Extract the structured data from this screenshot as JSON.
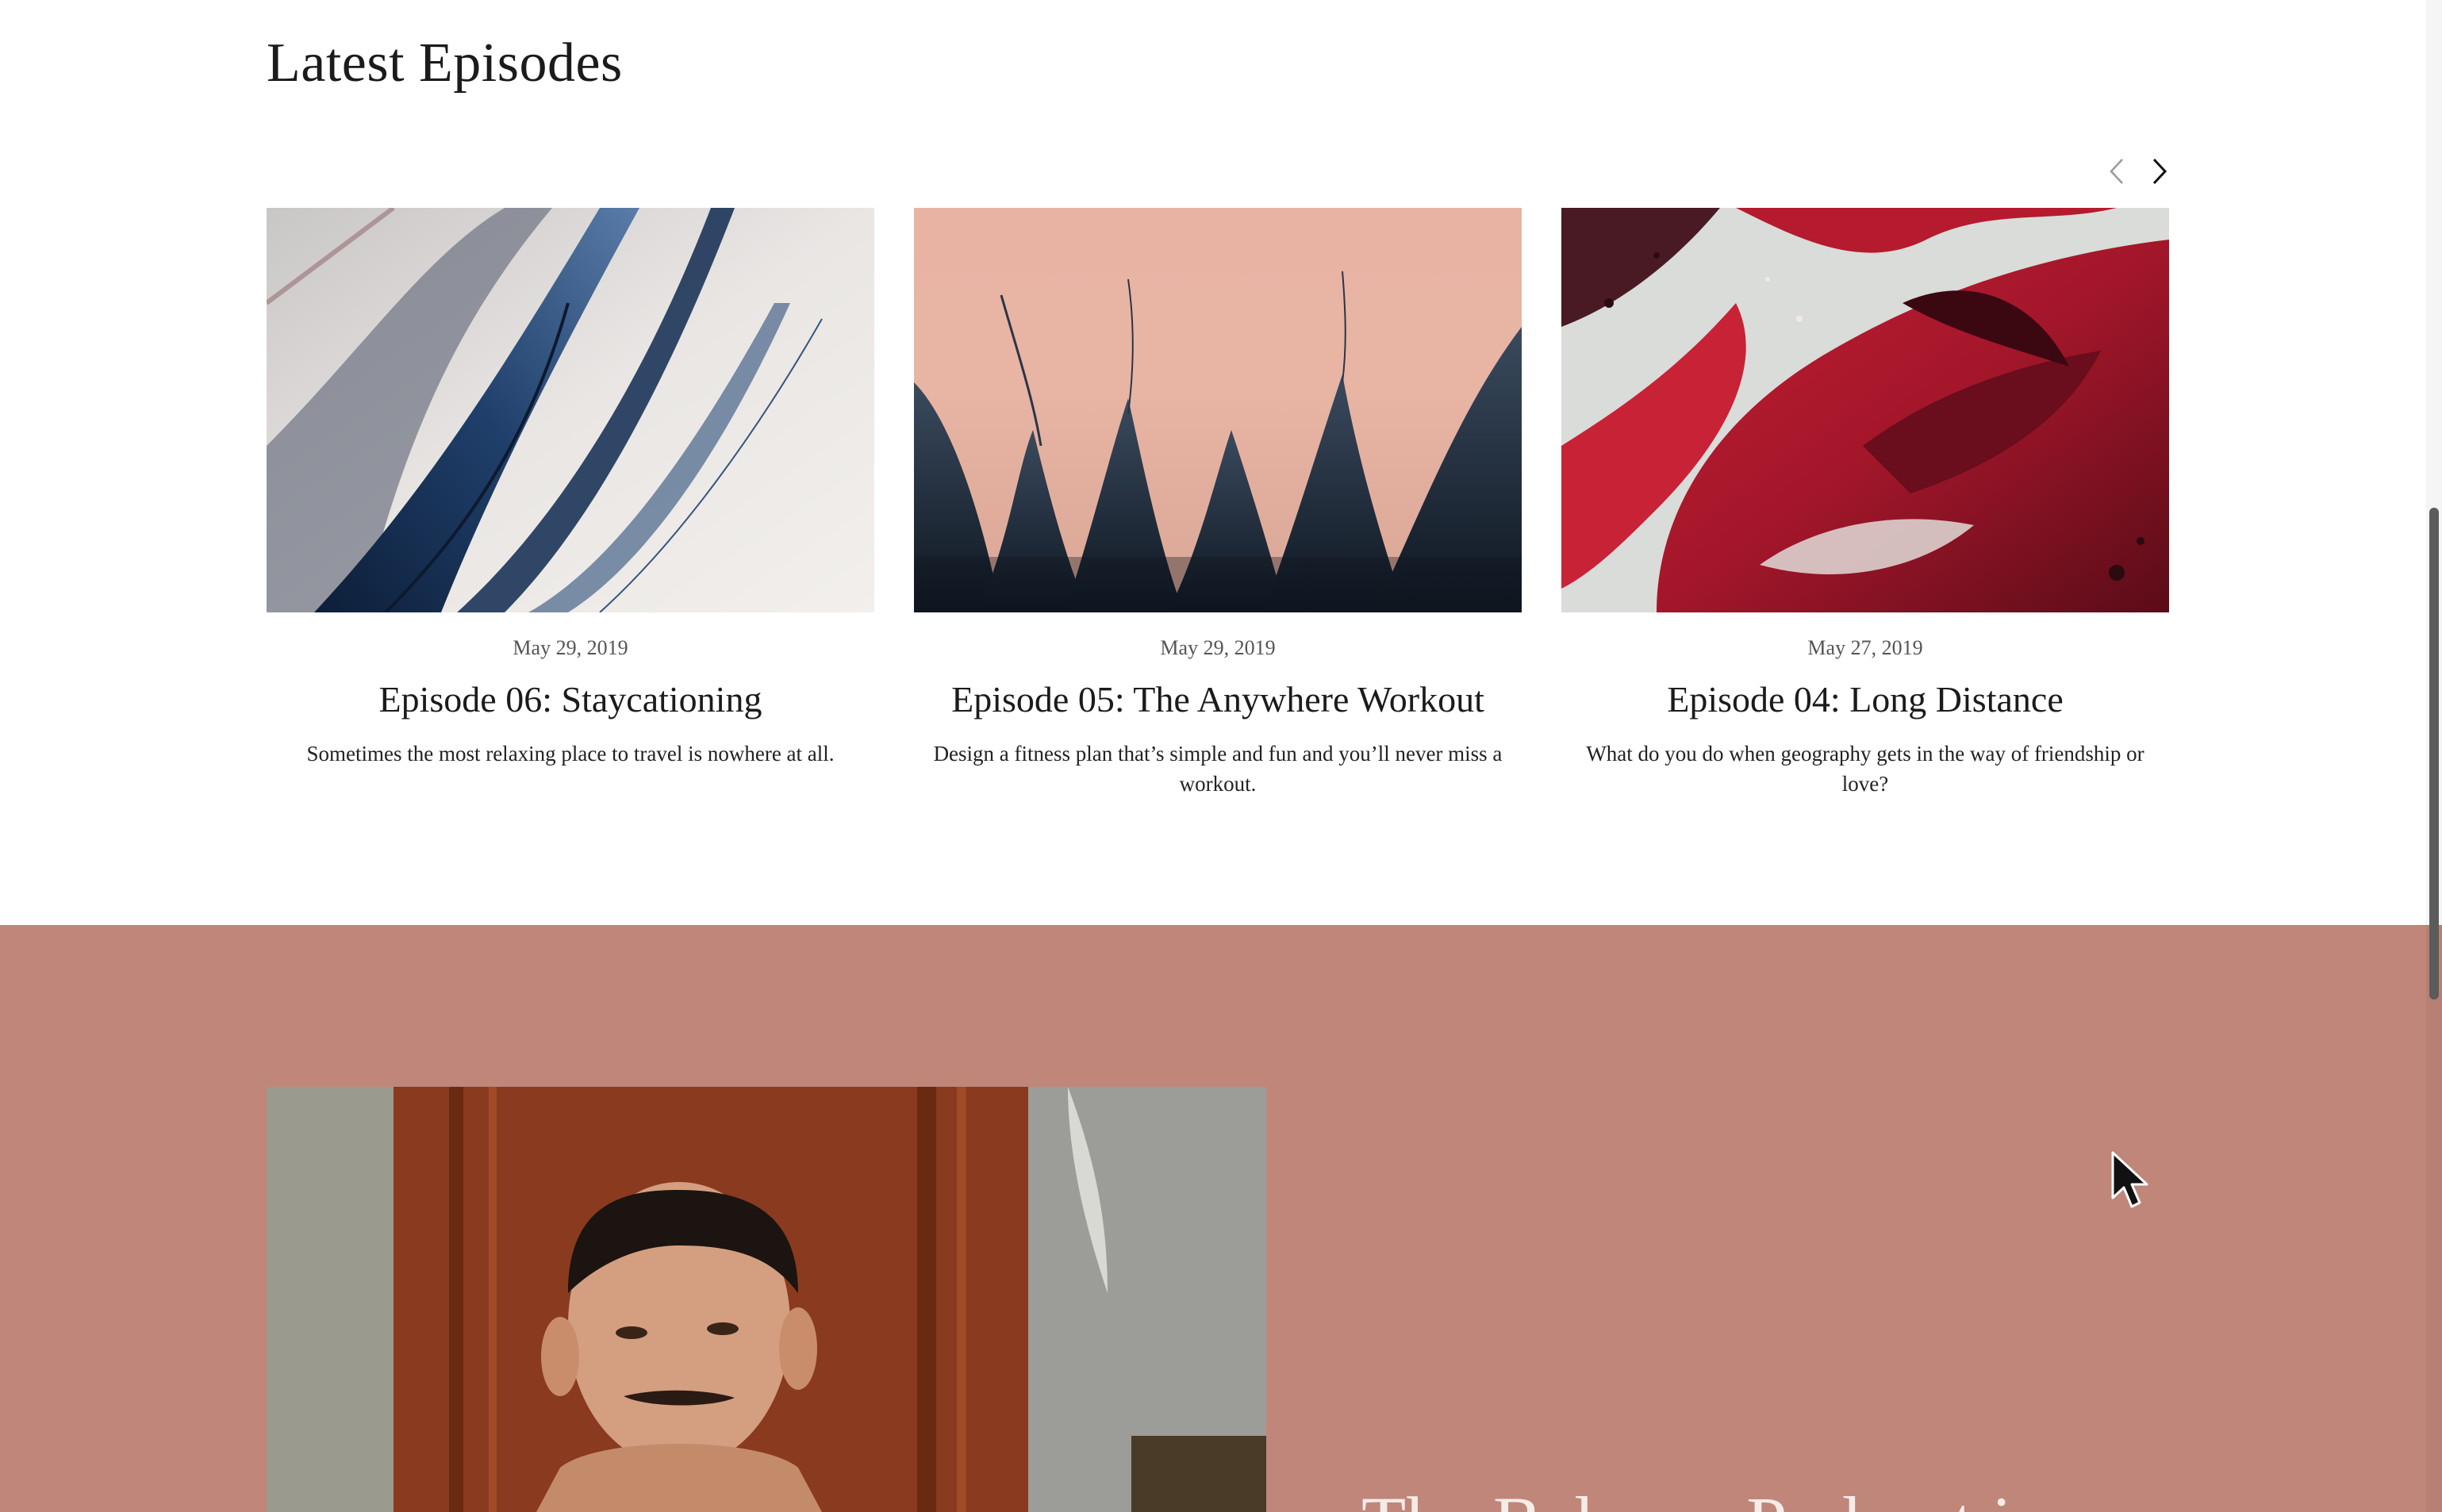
{
  "section": {
    "title": "Latest Episodes"
  },
  "carousel": {
    "prev_icon": "chevron-left-icon",
    "next_icon": "chevron-right-icon"
  },
  "episodes": [
    {
      "date": "May 29, 2019",
      "title": "Episode 06: Staycationing",
      "description": "Sometimes the most relaxing place to travel is nowhere at all."
    },
    {
      "date": "May 29, 2019",
      "title": "Episode 05: The Anywhere Workout",
      "description": "Design a fitness plan that’s simple and fun and you’ll never miss a workout."
    },
    {
      "date": "May 27, 2019",
      "title": "Episode 04: Long Distance",
      "description": "What do you do when geography gets in the way of friendship or love?"
    }
  ],
  "featured": {
    "background_color": "#c0867a",
    "heading": "The Balance Podcast is"
  }
}
